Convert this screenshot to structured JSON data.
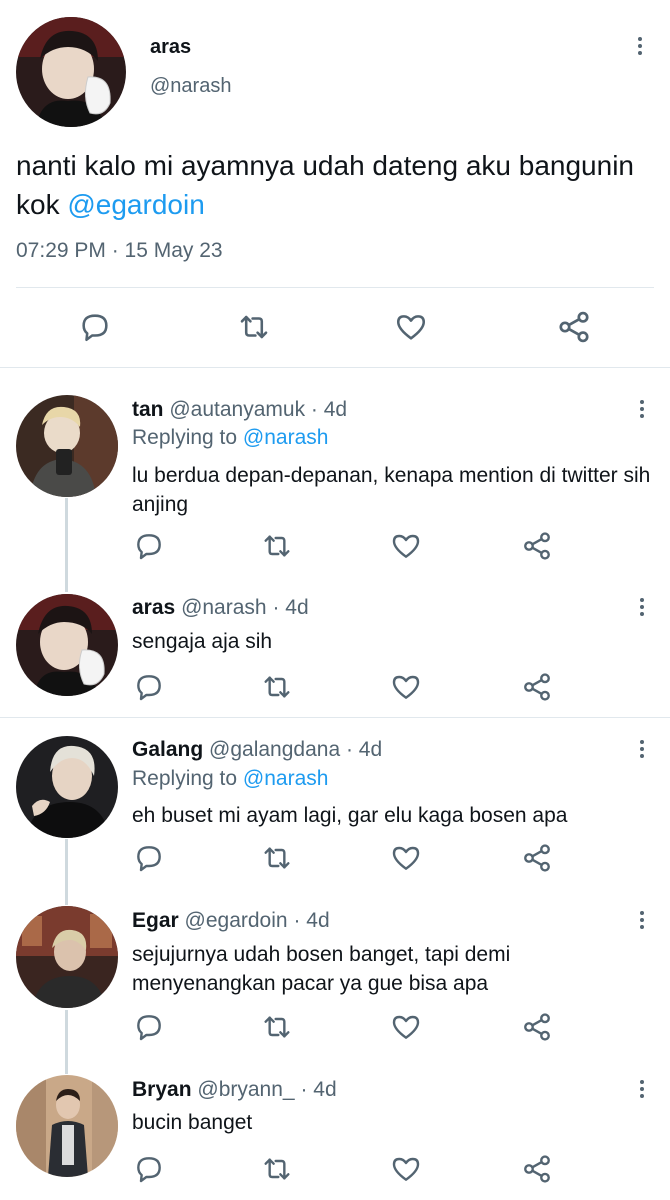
{
  "main_tweet": {
    "display_name": "aras",
    "handle": "@narash",
    "text_before": "nanti kalo mi ayamnya udah dateng aku bangunin kok ",
    "mention": "@egardoin",
    "timestamp": "07:29 PM · 15 May 23"
  },
  "replies": [
    {
      "display_name": "tan",
      "handle": "@autanyamuk",
      "age": "· 4d",
      "replying_label": "Replying to",
      "replying_to": "@narash",
      "text": "lu berdua depan-depanan, kenapa mention di twitter sih anjing"
    },
    {
      "display_name": "aras",
      "handle": "@narash",
      "age": "· 4d",
      "text": "sengaja aja sih"
    },
    {
      "display_name": "Galang",
      "handle": "@galangdana",
      "age": "· 4d",
      "replying_label": "Replying to",
      "replying_to": "@narash",
      "text": "eh buset mi ayam lagi, gar elu kaga bosen apa"
    },
    {
      "display_name": "Egar",
      "handle": "@egardoin",
      "age": "· 4d",
      "text": "sejujurnya udah bosen banget, tapi demi menyenangkan pacar ya gue bisa apa"
    },
    {
      "display_name": "Bryan",
      "handle": "@bryann_",
      "age": "· 4d",
      "text": "bucin banget"
    }
  ],
  "colors": {
    "accent": "#1d9bf0",
    "muted": "#536471",
    "text": "#0f1419",
    "divider": "#e1e8ed",
    "thread_line": "#cfd9de"
  },
  "icons": [
    "reply-icon",
    "retweet-icon",
    "like-icon",
    "share-icon",
    "more-icon"
  ]
}
